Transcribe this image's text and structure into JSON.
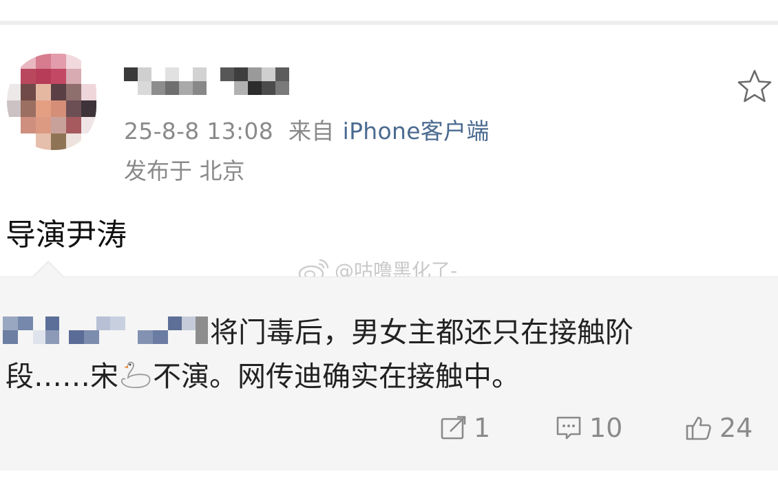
{
  "post": {
    "time": "25-8-8 13:08",
    "source_prefix": "来自",
    "client": "iPhone客户端",
    "location": "发布于 北京",
    "text": "导演尹涛"
  },
  "watermark": {
    "text": "@咕噜黑化了-"
  },
  "repost": {
    "line1": "将门毒后，男女主都还只在接触阶",
    "line2_a": "段……宋",
    "line2_b": "不演。网传迪确实在接触中。"
  },
  "actions": {
    "repost_count": "1",
    "comment_count": "10",
    "like_count": "24"
  },
  "icons": {
    "favorite": "star-icon",
    "repost": "share-icon",
    "comment": "comment-icon",
    "like": "thumbs-up-icon",
    "weibo": "weibo-logo-icon",
    "swan": "swan-emoji-icon"
  },
  "colors": {
    "client_link": "#4a6a8f",
    "meta_gray": "#8a8a8a",
    "card_bg": "#f5f5f5"
  }
}
